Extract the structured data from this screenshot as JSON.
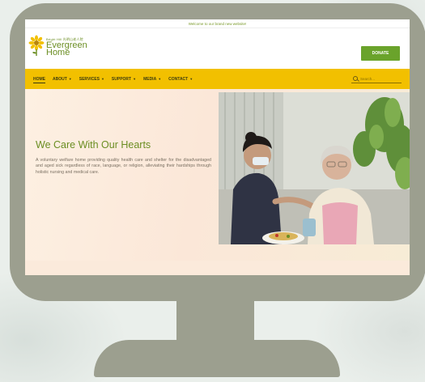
{
  "topbar": {
    "text": "Welcome to our brand new website!"
  },
  "logo": {
    "small_text": "Bright Hill 光明山老人院",
    "name_line1": "Evergreen",
    "name_line2": "Home"
  },
  "header": {
    "donate_label": "DONATE"
  },
  "nav": {
    "items": [
      {
        "label": "HOME",
        "has_caret": false,
        "active": true
      },
      {
        "label": "ABOUT",
        "has_caret": true,
        "active": false
      },
      {
        "label": "SERVICES",
        "has_caret": true,
        "active": false
      },
      {
        "label": "SUPPORT",
        "has_caret": true,
        "active": false
      },
      {
        "label": "MEDIA",
        "has_caret": true,
        "active": false
      },
      {
        "label": "CONTACT",
        "has_caret": true,
        "active": false
      }
    ],
    "caret": "▼",
    "search_placeholder": "Search..."
  },
  "hero": {
    "title": "We Care With Our Hearts",
    "description": "A voluntary welfare home providing quality health care and shelter for the disadvantaged and aged sick regardless of race, language, or religion, alleviating their hardships through holistic nursing and medical care."
  },
  "colors": {
    "monitor": "#9c9f8f",
    "brand_green": "#6b8e23",
    "donate_green": "#6aa32b",
    "nav_yellow": "#f2c000"
  }
}
